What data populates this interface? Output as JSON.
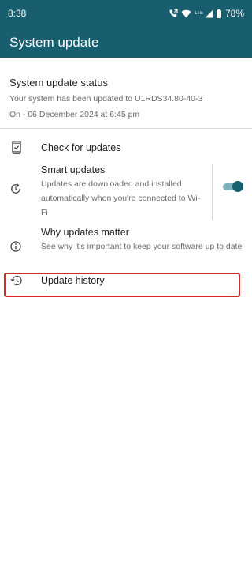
{
  "status_bar": {
    "time": "8:38",
    "network_label": "LTE",
    "battery": "78%"
  },
  "app_bar": {
    "title": "System update"
  },
  "status": {
    "title": "System update status",
    "line1": "Your system has been updated to U1RDS34.80-40-3",
    "line2": "On - 06 December 2024 at 6:45 pm"
  },
  "items": {
    "check": {
      "icon": "phone-check-icon",
      "label": "Check for updates"
    },
    "smart": {
      "icon": "refresh-clock-icon",
      "label": "Smart updates",
      "description": "Updates are downloaded and installed automatically when you're connected to Wi-Fi",
      "toggle_on": true
    },
    "why": {
      "icon": "info-icon",
      "label": "Why updates matter",
      "description": "See why it's important to keep your software up to date"
    },
    "history": {
      "icon": "history-icon",
      "label": "Update history"
    }
  },
  "colors": {
    "header": "#185e6e",
    "accent": "#16606f",
    "highlight": "#d02a2a"
  }
}
